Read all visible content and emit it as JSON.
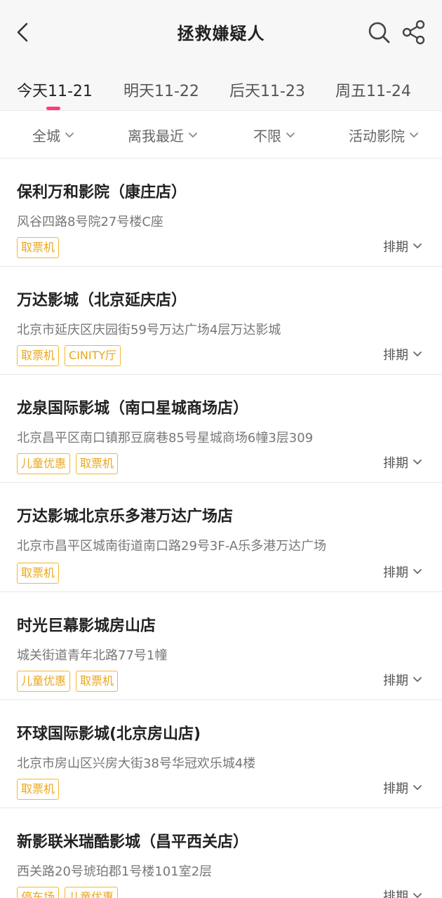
{
  "header": {
    "title": "拯救嫌疑人"
  },
  "tabs": [
    {
      "label": "今天11-21",
      "active": true
    },
    {
      "label": "明天11-22",
      "active": false
    },
    {
      "label": "后天11-23",
      "active": false
    },
    {
      "label": "周五11-24",
      "active": false
    }
  ],
  "filters": [
    {
      "label": "全城"
    },
    {
      "label": "离我最近"
    },
    {
      "label": "不限"
    },
    {
      "label": "活动影院"
    }
  ],
  "cinemas": [
    {
      "name": "保利万和影院（康庄店）",
      "address": "风谷四路8号院27号楼C座",
      "tags": [
        "取票机"
      ],
      "action": "排期"
    },
    {
      "name": "万达影城（北京延庆店）",
      "address": "北京市延庆区庆园街59号万达广场4层万达影城",
      "tags": [
        "取票机",
        "CINITY厅"
      ],
      "action": "排期"
    },
    {
      "name": "龙泉国际影城（南口星城商场店）",
      "address": "北京昌平区南口镇那豆腐巷85号星城商场6幢3层309",
      "tags": [
        "儿童优惠",
        "取票机"
      ],
      "action": "排期"
    },
    {
      "name": "万达影城北京乐多港万达广场店",
      "address": "北京市昌平区城南街道南口路29号3F-A乐多港万达广场",
      "tags": [
        "取票机"
      ],
      "action": "排期"
    },
    {
      "name": "时光巨幕影城房山店",
      "address": "城关街道青年北路77号1幢",
      "tags": [
        "儿童优惠",
        "取票机"
      ],
      "action": "排期"
    },
    {
      "name": "环球国际影城(北京房山店)",
      "address": "北京市房山区兴房大街38号华冠欢乐城4楼",
      "tags": [
        "取票机"
      ],
      "action": "排期"
    },
    {
      "name": "新影联米瑞酷影城（昌平西关店）",
      "address": "西关路20号琥珀郡1号楼101室2层",
      "tags": [
        "停车场",
        "儿童优惠"
      ],
      "action": "排期"
    }
  ],
  "colors": {
    "accent": "#ff3c77",
    "tag": "#eaa61a"
  }
}
